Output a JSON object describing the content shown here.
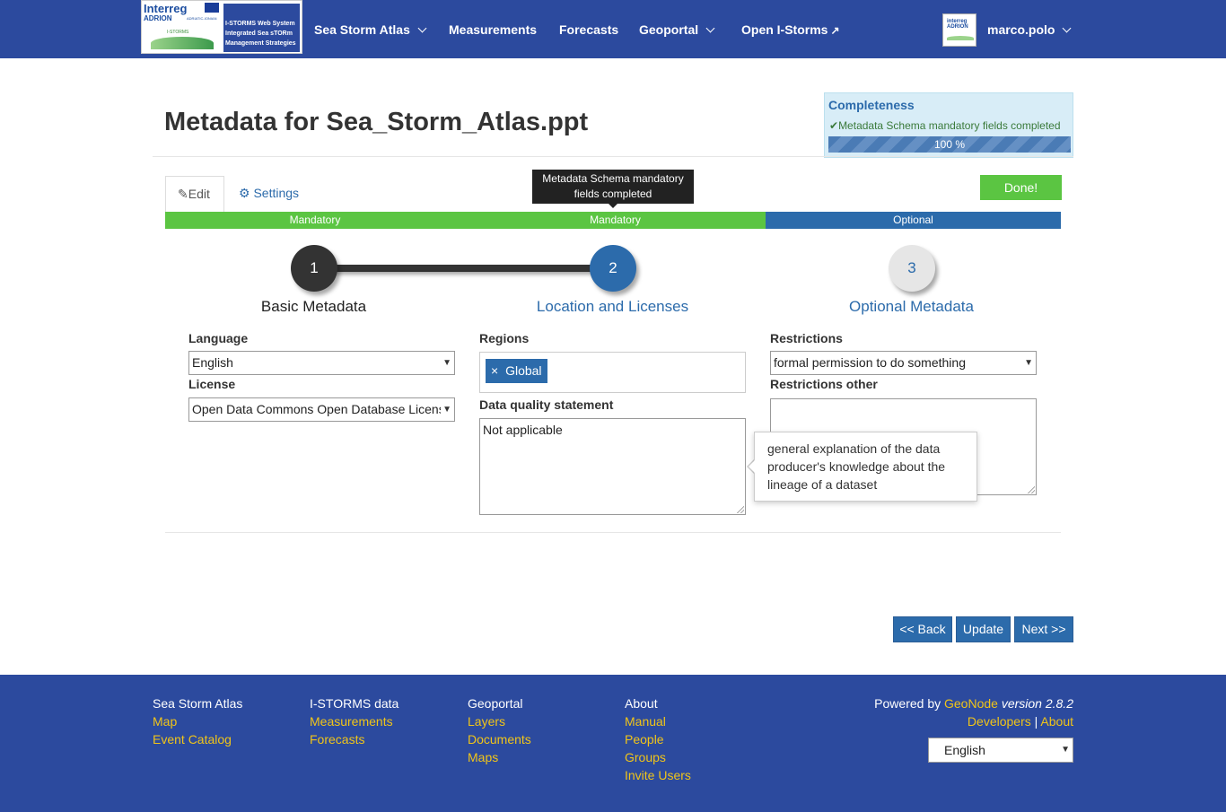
{
  "nav": {
    "logo": {
      "left_line1": "Interreg",
      "left_line2": "ADRION",
      "left_line3": "ADRIATIC-IONIAN",
      "left_line4": "I-STORMS",
      "right_line1": "I-STORMS Web System",
      "right_line2": "Integrated Sea sTORm",
      "right_line3": "Management Strategies"
    },
    "items": [
      {
        "label": "Sea Storm Atlas",
        "dropdown": true
      },
      {
        "label": "Measurements",
        "dropdown": false
      },
      {
        "label": "Forecasts",
        "dropdown": false
      },
      {
        "label": "Geoportal",
        "dropdown": true
      },
      {
        "label": "Open I-Storms",
        "dropdown": false,
        "external": true
      }
    ],
    "user": {
      "name": "marco.polo",
      "avatar_text": "interreg ADRION"
    }
  },
  "header": {
    "title": "Metadata for Sea_Storm_Atlas.ppt"
  },
  "completeness": {
    "title": "Completeness",
    "message": "Metadata Schema mandatory fields completed",
    "progress_label": "100 %",
    "progress": 1.0
  },
  "tabs": {
    "edit": "Edit",
    "settings": "Settings"
  },
  "done_button": "Done!",
  "tooltip": {
    "line1": "Metadata Schema mandatory",
    "line2": "fields completed"
  },
  "segments": [
    "Mandatory",
    "Mandatory",
    "Optional"
  ],
  "steps": [
    {
      "number": "1",
      "label": "Basic Metadata"
    },
    {
      "number": "2",
      "label": "Location and Licenses"
    },
    {
      "number": "3",
      "label": "Optional Metadata"
    }
  ],
  "form": {
    "language": {
      "label": "Language",
      "value": "English"
    },
    "license": {
      "label": "License",
      "value": "Open Data Commons Open Database License"
    },
    "regions": {
      "label": "Regions",
      "tag": "Global",
      "tag_remove": "×"
    },
    "data_quality": {
      "label": "Data quality statement",
      "value": "Not applicable"
    },
    "restrictions": {
      "label": "Restrictions",
      "value": "formal permission to do something"
    },
    "restrictions_other": {
      "label": "Restrictions other",
      "value": ""
    }
  },
  "popover": {
    "text": "general explanation of the data producer's knowledge about the lineage of a dataset"
  },
  "pager": {
    "back": "<< Back",
    "update": "Update",
    "next": "Next >>"
  },
  "footer": {
    "col1": {
      "head": "Sea Storm Atlas",
      "links": [
        "Map",
        "Event Catalog"
      ]
    },
    "col2": {
      "head": "I-STORMS data",
      "links": [
        "Measurements",
        "Forecasts"
      ]
    },
    "col3": {
      "head": "Geoportal",
      "links": [
        "Layers",
        "Documents",
        "Maps"
      ]
    },
    "col4": {
      "head": "About",
      "links": [
        "Manual",
        "People",
        "Groups",
        "Invite Users"
      ]
    },
    "powered_prefix": "Powered by",
    "powered_link": "GeoNode",
    "version": "version 2.8.2",
    "developers": "Developers",
    "separator": "|",
    "about": "About",
    "language": "English"
  },
  "colors": {
    "navbar": "#2c4a9e",
    "primary": "#2c6bab",
    "success": "#5bc542",
    "footer_link": "#f0c419"
  }
}
